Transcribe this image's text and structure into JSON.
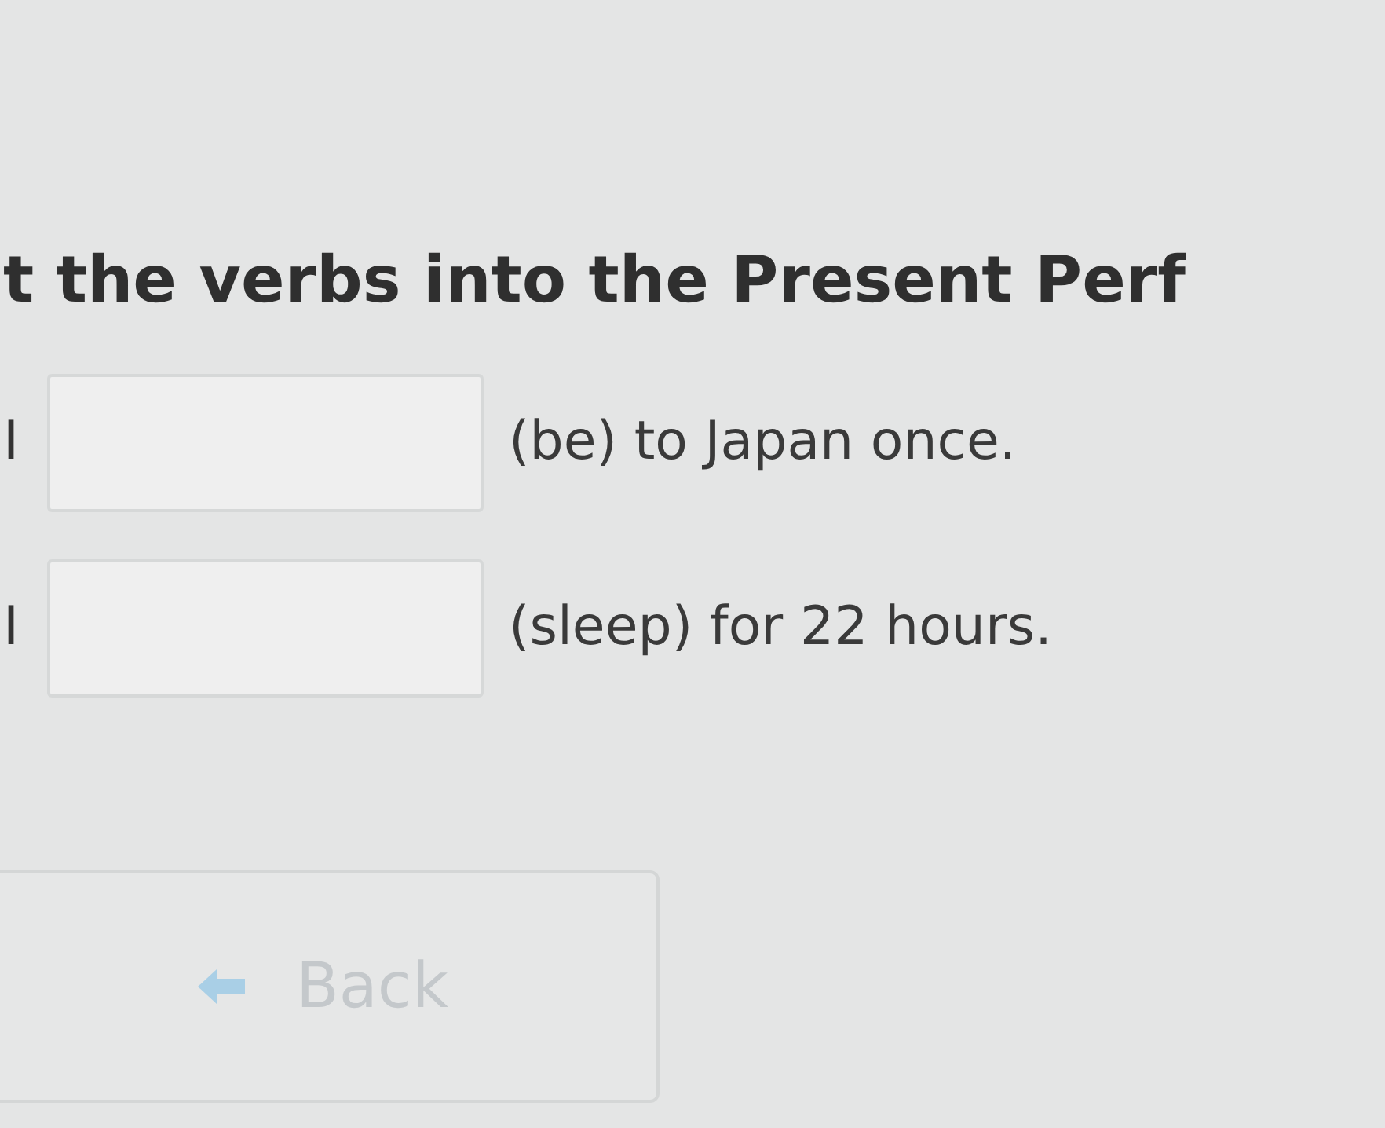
{
  "instruction": "t the verbs into the Present Perf",
  "items": [
    {
      "subject": "I",
      "rest": "(be) to Japan once."
    },
    {
      "subject": "I",
      "rest": "(sleep) for 22 hours."
    }
  ],
  "back_button": {
    "label": "Back",
    "disabled": true
  }
}
